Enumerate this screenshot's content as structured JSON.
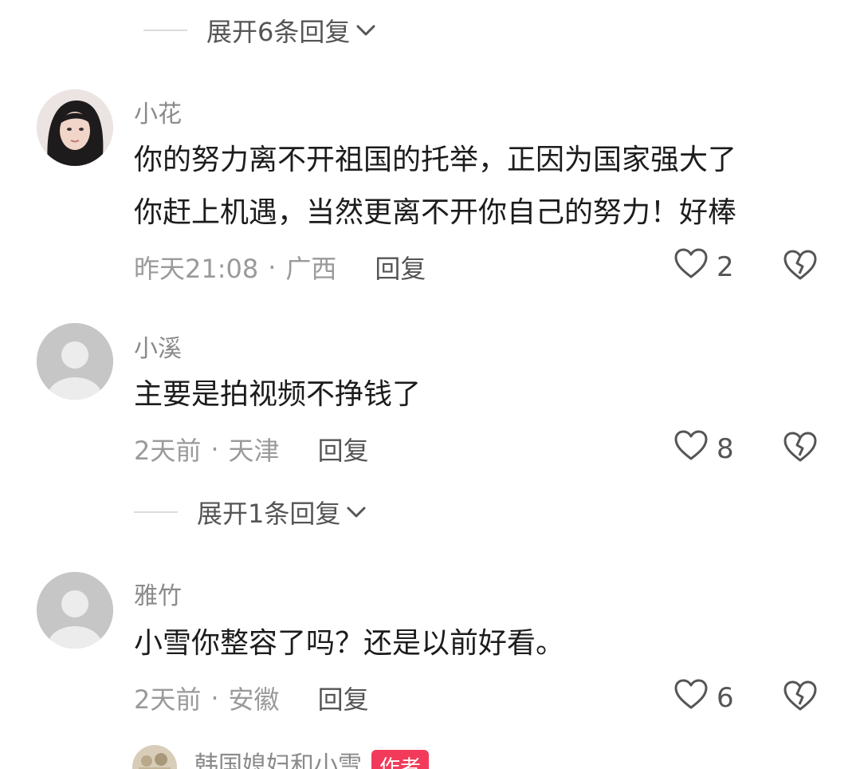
{
  "expand_replies_top": "展开6条回复",
  "comments": [
    {
      "username": "小花",
      "text_line1": "你的努力离不开祖国的托举，正因为国家强大了",
      "text_line2": "你赶上机遇，当然更离不开你自己的努力！好棒",
      "time": "昨天21:08",
      "location": "广西",
      "reply_label": "回复",
      "likes": "2"
    },
    {
      "username": "小溪",
      "text_line1": "主要是拍视频不挣钱了",
      "time": "2天前",
      "location": "天津",
      "reply_label": "回复",
      "likes": "8"
    },
    {
      "username": "雅竹",
      "text_line1": "小雪你整容了吗？还是以前好看。",
      "time": "2天前",
      "location": "安徽",
      "reply_label": "回复",
      "likes": "6"
    }
  ],
  "expand_replies_mid": "展开1条回复",
  "partial_reply": {
    "username": "韩国媳妇和小雪",
    "badge": "作者"
  },
  "meta_separator": "·",
  "colors": {
    "author_badge": "#f23b5a",
    "muted_text": "#9a9a9a"
  },
  "icons": [
    "chevron-down-icon",
    "heart-outline-icon",
    "broken-heart-icon",
    "default-avatar-icon"
  ]
}
